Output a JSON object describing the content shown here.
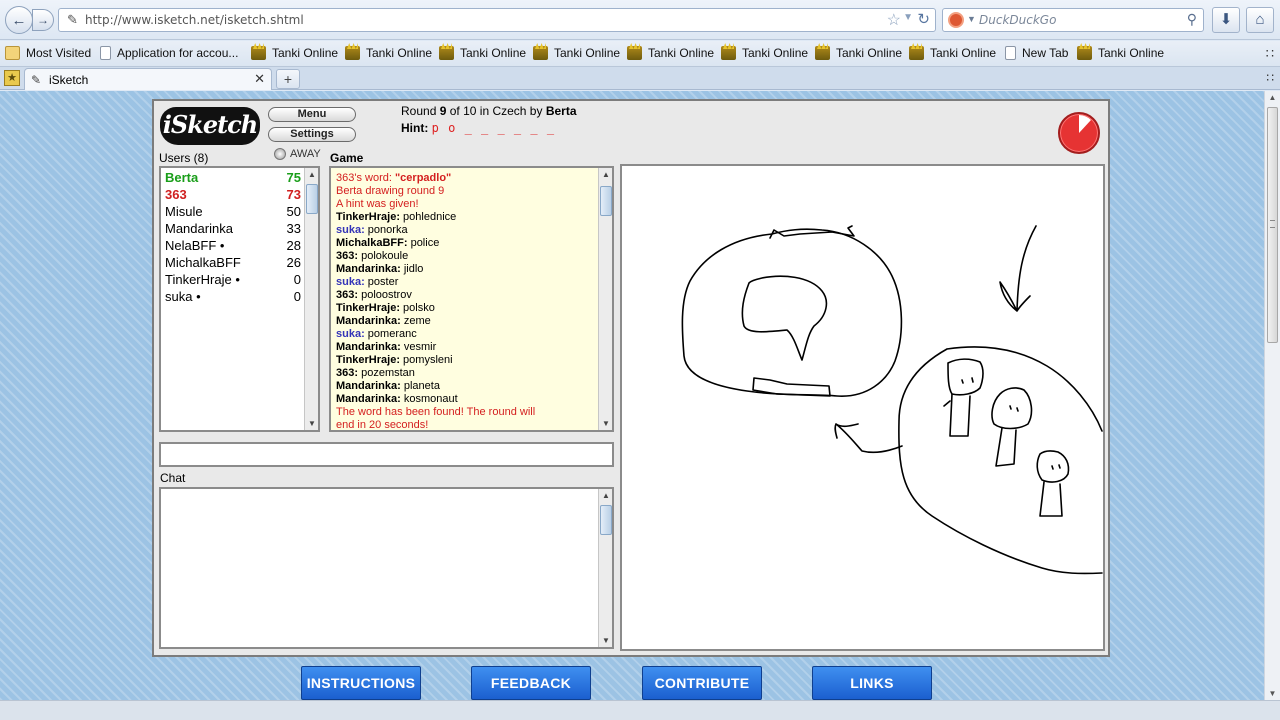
{
  "browser": {
    "url": "http://www.isketch.net/isketch.shtml",
    "search_placeholder": "DuckDuckGo",
    "bookmarks": [
      "Most Visited",
      "Application for accou...",
      "Tanki Online",
      "Tanki Online",
      "Tanki Online",
      "Tanki Online",
      "Tanki Online",
      "Tanki Online",
      "Tanki Online",
      "Tanki Online",
      "New Tab",
      "Tanki Online"
    ],
    "tab_title": "iSketch"
  },
  "game": {
    "logo": "iSketch",
    "menu_label": "Menu",
    "settings_label": "Settings",
    "round_prefix": "Round",
    "round_number": "9",
    "round_of": "of 10 in Czech by",
    "drawer": "Berta",
    "hint_label": "Hint:",
    "hint_value": "p o _ _ _ _ _ _",
    "users_header": "Users (8)",
    "away_label": "AWAY",
    "game_header": "Game",
    "chat_header": "Chat",
    "users": [
      {
        "name": "Berta",
        "score": "75"
      },
      {
        "name": "363",
        "score": "73"
      },
      {
        "name": "Misule",
        "score": "50"
      },
      {
        "name": "Mandarinka",
        "score": "33"
      },
      {
        "name": "NelaBFF •",
        "score": "28"
      },
      {
        "name": "MichalkaBFF",
        "score": "26"
      },
      {
        "name": "TinkerHraje •",
        "score": "0"
      },
      {
        "name": "suka •",
        "score": "0"
      }
    ],
    "log": {
      "word_prefix": "363's word: ",
      "word": "\"cerpadlo\"",
      "berta_drawing": "Berta drawing round 9",
      "hint_given": "A hint was given!",
      "guesses": [
        {
          "name": "TinkerHraje:",
          "text": " pohlednice"
        },
        {
          "name": "suka:",
          "text": " ponorka"
        },
        {
          "name": "MichalkaBFF:",
          "text": " police"
        },
        {
          "name": "363:",
          "text": " polokoule"
        },
        {
          "name": "Mandarinka:",
          "text": " jidlo"
        },
        {
          "name": "suka:",
          "text": " poster"
        },
        {
          "name": "363:",
          "text": " poloostrov"
        },
        {
          "name": "TinkerHraje:",
          "text": " polsko"
        },
        {
          "name": "Mandarinka:",
          "text": " zeme"
        },
        {
          "name": "suka:",
          "text": " pomeranc"
        },
        {
          "name": "Mandarinka:",
          "text": " vesmir"
        },
        {
          "name": "TinkerHraje:",
          "text": " pomysleni"
        },
        {
          "name": "363:",
          "text": " pozemstan"
        },
        {
          "name": "Mandarinka:",
          "text": " planeta"
        },
        {
          "name": "Mandarinka:",
          "text": " kosmonaut"
        }
      ],
      "found_line1": "The word has been found! The round will",
      "found_line2": "end in 20 seconds!"
    },
    "guess_value": ""
  },
  "footer": {
    "instructions": "INSTRUCTIONS",
    "feedback": "FEEDBACK",
    "contribute": "CONTRIBUTE",
    "links": "LINKS"
  },
  "colors": {
    "leader_green": "#1a9e1a",
    "alert_red": "#d42020",
    "guesser_blue": "#3434b8",
    "footer_blue": "#1b5fcf",
    "log_background": "#fffee0"
  },
  "icons": [
    "back-icon",
    "forward-icon",
    "pen-icon",
    "star-icon",
    "reload-icon",
    "duckduckgo-icon",
    "search-icon",
    "download-icon",
    "home-icon",
    "page-icon",
    "tanki-icon",
    "close-icon",
    "plus-icon",
    "timer-icon"
  ]
}
